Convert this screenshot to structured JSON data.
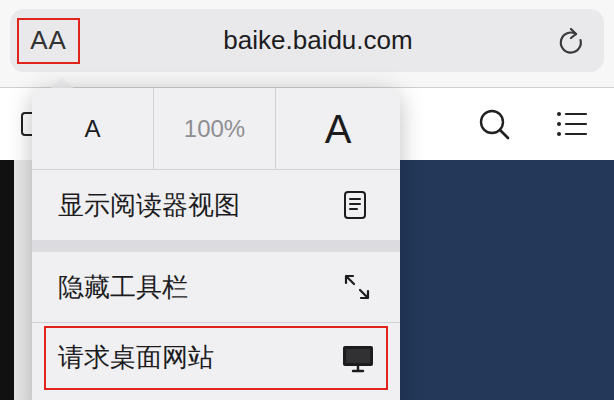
{
  "address_bar": {
    "reader_button": {
      "label": "AA",
      "highlighted": true
    },
    "url": "baike.baidu.com"
  },
  "menu": {
    "font_size": {
      "smaller": "A",
      "zoom": "100%",
      "larger": "A"
    },
    "items": [
      {
        "label": "显示阅读器视图",
        "kind": "reader",
        "highlighted": false
      },
      {
        "label": "隐藏工具栏",
        "kind": "toolbar",
        "highlighted": false
      },
      {
        "label": "请求桌面网站",
        "kind": "desktop",
        "highlighted": true
      }
    ]
  }
}
